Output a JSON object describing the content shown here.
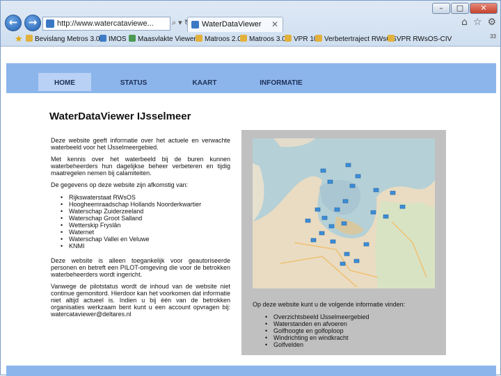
{
  "browser": {
    "url": "http://www.watercataviewe...",
    "tab_title": "WaterDataViewer",
    "favorites": [
      {
        "label": "Bevislang Metros 3.0"
      },
      {
        "label": "IMOS"
      },
      {
        "label": "Maasvlakte Viewer"
      },
      {
        "label": "Matroos 2.0"
      },
      {
        "label": "Matroos 3.0"
      },
      {
        "label": "VPR 10"
      },
      {
        "label": "Verbetertraject RWsOS"
      },
      {
        "label": "VPR RWsOS-CIV"
      }
    ],
    "page_number": "33"
  },
  "menu": {
    "items": [
      {
        "label": "HOME"
      },
      {
        "label": "STATUS"
      },
      {
        "label": "KAART"
      },
      {
        "label": "INFORMATIE"
      }
    ]
  },
  "main": {
    "title": "WaterDataViewer IJsselmeer",
    "para1": "Deze website geeft informatie over het actuele en verwachte waterbeeld voor het IJsselmeergebied.",
    "para2": "Met kennis over het waterbeeld bij de buren kunnen waterbeheerders hun dagelijkse beheer verbeteren en tijdig maatregelen nemen bij calamiteiten.",
    "para3": "De gegevens op deze website zijn afkomstig van:",
    "sources": [
      "Rijkswaterstaat RWsOS",
      "Hoogheemraadschap Hollands Noorderkwartier",
      "Waterschap Zuiderzeeland",
      "Waterschap Groot Salland",
      "Wetterskip Fryslân",
      "Waternet",
      "Waterschap Vallei en Veluwe",
      "KNMI"
    ],
    "para4": "Deze website is alleen toegankelijk voor geautoriseerde personen en betreft een PILOT-omgeving die voor de betrokken waterbeheerders wordt ingericht.",
    "para5": "Vanwege de pilotstatus wordt de inhoud van de website niet continue gemonitord. Hierdoor kan het voorkomen dat informatie niet altijd actueel is. Indien u bij één van de betrokken organisaties werkzaam bent kunt u een account opvragen bij: watercataviewer@deltares.nl"
  },
  "panel": {
    "intro": "Op deze website kunt u de volgende informatie vinden:",
    "items": [
      "Overzichtsbeeld IJsselmeergebied",
      "Waterstanden en afvoeren",
      "Golfhoogte en golfoploop",
      "Windrichting en windkracht",
      "Golfvelden"
    ]
  },
  "colors": {
    "header_band": "#8cb5ec",
    "active_tab": "#b9d1f4",
    "panel_bg": "#c0c0c0",
    "map_water": "#b5d0d6",
    "map_land": "#e9dcc2",
    "marker": "#3d8ed8"
  },
  "icons": [
    "back-icon",
    "forward-icon",
    "search-icon",
    "refresh-icon",
    "close-icon",
    "home-icon",
    "star-icon",
    "gear-icon"
  ]
}
